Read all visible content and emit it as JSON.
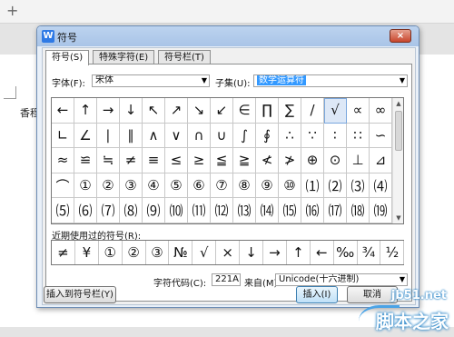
{
  "background": {
    "plus_label": "+",
    "page_text": "香程"
  },
  "dialog": {
    "title": "符号",
    "app_icon_letter": "W",
    "close_label": "×",
    "tabs": [
      {
        "label": "符号(S)"
      },
      {
        "label": "特殊字符(E)"
      },
      {
        "label": "符号栏(T)"
      }
    ],
    "font_label": "字体(F):",
    "font_value": "宋体",
    "subset_label": "子集(U):",
    "subset_value": "数学运算符",
    "symbols": [
      "←",
      "↑",
      "→",
      "↓",
      "↖",
      "↗",
      "↘",
      "↙",
      "∈",
      "∏",
      "∑",
      "/",
      "√",
      "∝",
      "∞",
      "∟",
      "∠",
      "∣",
      "∥",
      "∧",
      "∨",
      "∩",
      "∪",
      "∫",
      "∮",
      "∴",
      "∵",
      "∶",
      "∷",
      "∽",
      "≈",
      "≌",
      "≒",
      "≠",
      "≡",
      "≤",
      "≥",
      "≦",
      "≧",
      "≮",
      "≯",
      "⊕",
      "⊙",
      "⊥",
      "⊿",
      "⌒",
      "①",
      "②",
      "③",
      "④",
      "⑤",
      "⑥",
      "⑦",
      "⑧",
      "⑨",
      "⑩",
      "⑴",
      "⑵",
      "⑶",
      "⑷",
      "⑸",
      "⑹",
      "⑺",
      "⑻",
      "⑼",
      "⑽",
      "⑾",
      "⑿",
      "⒀",
      "⒁",
      "⒂",
      "⒃",
      "⒄",
      "⒅",
      "⒆"
    ],
    "selected_symbol": "√",
    "recent_label": "近期使用过的符号(R):",
    "recent_symbols": [
      "≠",
      "¥",
      "①",
      "②",
      "③",
      "№",
      "√",
      "×",
      "↓",
      "→",
      "↑",
      "←",
      "‰",
      "¾",
      "½"
    ],
    "charcode_label": "字符代码(C):",
    "charcode_value": "221A",
    "from_label": "来自(M)",
    "from_value": "Unicode(十六进制)",
    "add_to_bar_button": "插入到符号栏(Y)",
    "insert_button": "插入(I)",
    "cancel_button": "取消"
  },
  "watermark": {
    "url": "jb51.net",
    "name": "脚本之家"
  }
}
